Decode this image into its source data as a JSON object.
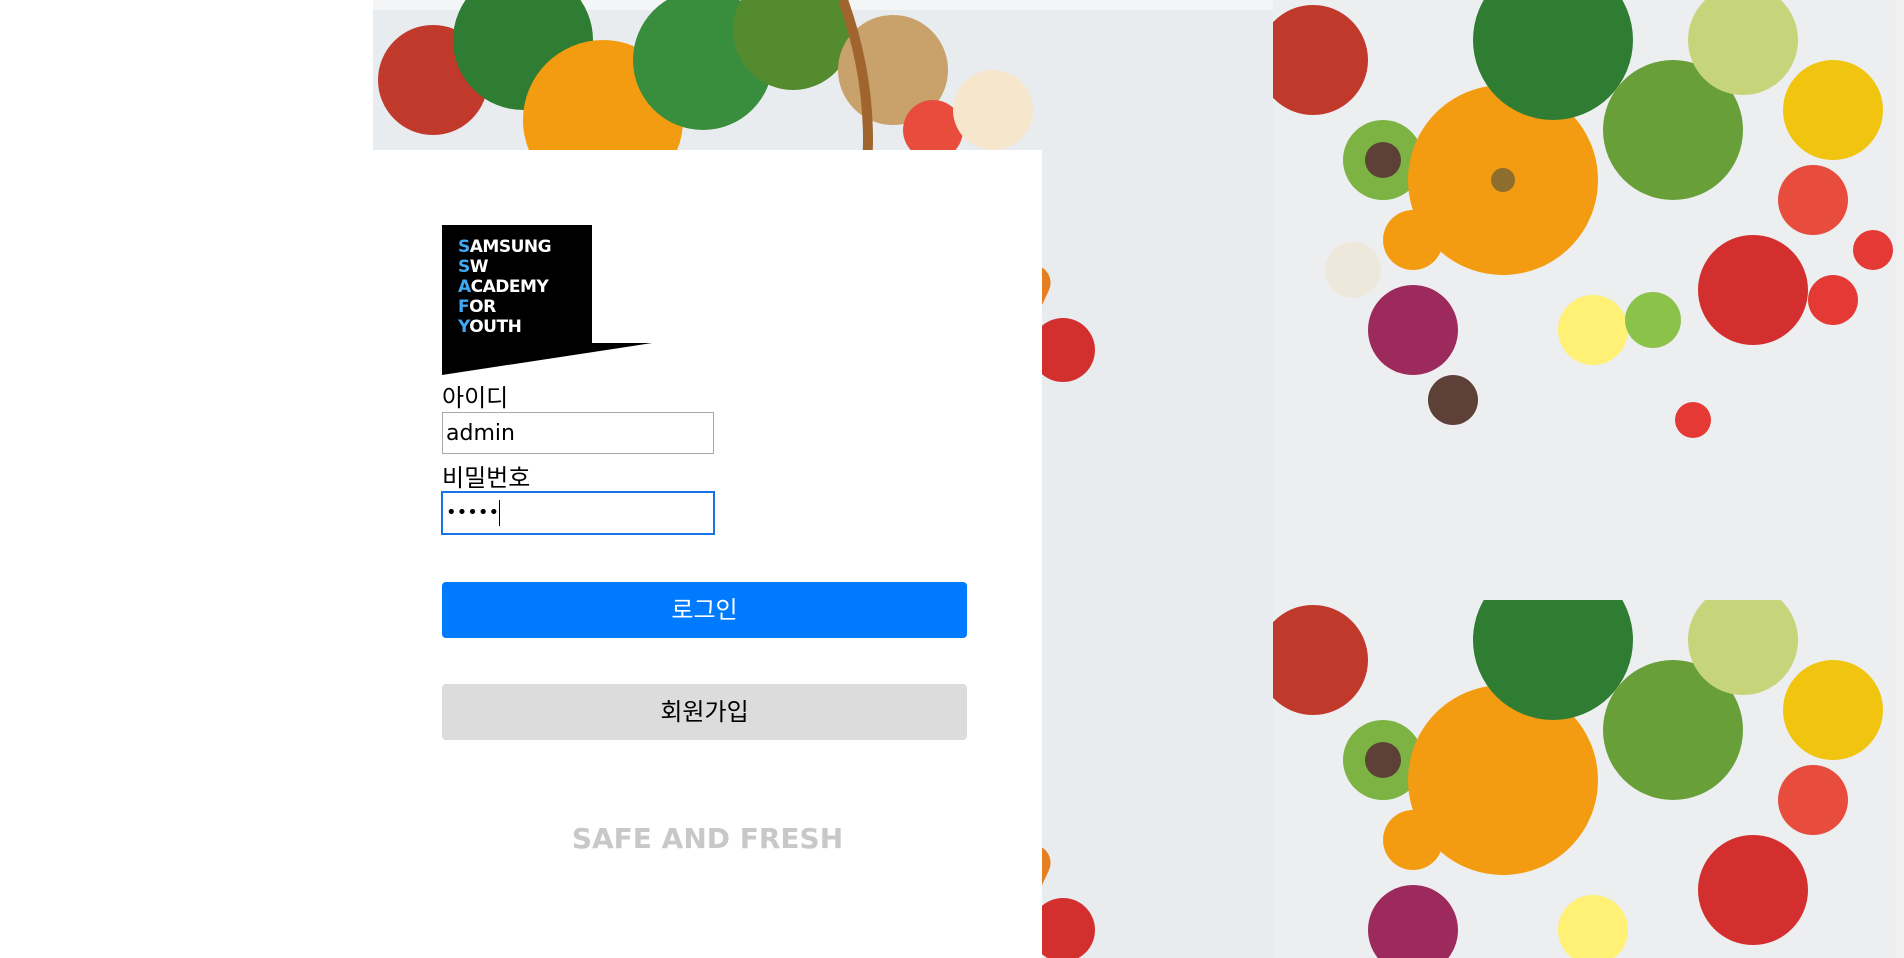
{
  "logo": {
    "lines": [
      {
        "first": "S",
        "rest": "AMSUNG"
      },
      {
        "first": "S",
        "rest": "W"
      },
      {
        "first": "A",
        "rest": "CADEMY"
      },
      {
        "first": "F",
        "rest": "OR"
      },
      {
        "first": "Y",
        "rest": "OUTH"
      }
    ]
  },
  "form": {
    "id_label": "아이디",
    "id_value": "admin",
    "password_label": "비밀번호",
    "password_value": "•••••"
  },
  "buttons": {
    "login_label": "로그인",
    "signup_label": "회원가입"
  },
  "tagline": "SAFE AND FRESH",
  "colors": {
    "primary": "#007bff",
    "secondary": "#dcdcdc",
    "tagline": "#c8c8c8"
  },
  "background": {
    "image_icon": "vegetables-photo"
  }
}
